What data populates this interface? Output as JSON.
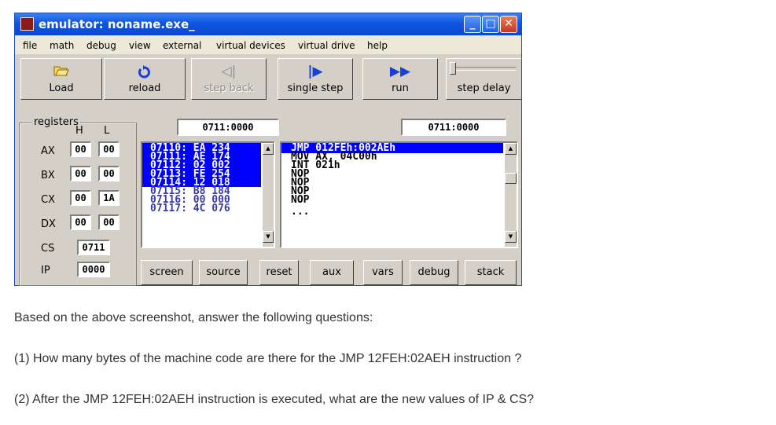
{
  "window": {
    "title": "emulator: noname.exe_"
  },
  "menu": [
    "file",
    "math",
    "debug",
    "view",
    "external",
    "virtual devices",
    "virtual drive",
    "help"
  ],
  "toolbar": {
    "load": "Load",
    "reload": "reload",
    "step_back": "step back",
    "single_step": "single step",
    "run": "run",
    "step_delay": "step delay"
  },
  "registers": {
    "group_label": "registers",
    "col_h": "H",
    "col_l": "L",
    "rows": [
      {
        "name": "AX",
        "h": "00",
        "l": "00"
      },
      {
        "name": "BX",
        "h": "00",
        "l": "00"
      },
      {
        "name": "CX",
        "h": "00",
        "l": "1A"
      },
      {
        "name": "DX",
        "h": "00",
        "l": "00"
      }
    ],
    "cs_label": "CS",
    "cs": "0711",
    "ip_label": "IP",
    "ip": "0000"
  },
  "memory": {
    "address": "0711:0000",
    "lines": [
      "07110: EA 234",
      "07111: AE 174",
      "07112: 02 002",
      "07113: FE 254",
      "07114: 12 018",
      "07115: B8 184",
      "07116: 00 000",
      "07117: 4C 076"
    ]
  },
  "disasm": {
    "address": "0711:0000",
    "lines": [
      "JMP 012FEh:002AEh",
      "MOV AX, 04C00h",
      "INT 021h",
      "NOP",
      "NOP",
      "NOP",
      "NOP",
      "..."
    ]
  },
  "bottom_buttons": [
    "screen",
    "source",
    "reset",
    "aux",
    "vars",
    "debug",
    "stack"
  ],
  "questions": {
    "intro": "Based on the above screenshot, answer the following questions:",
    "q1": "(1) How many bytes of the machine code are there for the JMP 12FEH:02AEH instruction ?",
    "q2": "(2) After the JMP 12FEH:02AEH instruction is executed, what are the new values of IP & CS?"
  },
  "colors": {
    "selection": "#0000ff",
    "title_blue": "#0f55e0",
    "face": "#d4d0c8",
    "menu_bg": "#ece9d8",
    "window_frame": "#c9d8f5"
  }
}
